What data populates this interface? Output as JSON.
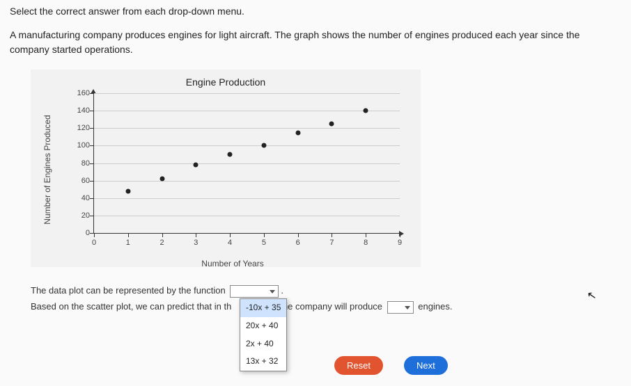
{
  "instruction": "Select the correct answer from each drop-down menu.",
  "context": "A manufacturing company produces engines for light aircraft. The graph shows the number of engines produced each year since the company started operations.",
  "chart_data": {
    "type": "scatter",
    "title": "Engine Production",
    "xlabel": "Number of Years",
    "ylabel": "Number of Engines Produced",
    "xlim": [
      0,
      9
    ],
    "ylim": [
      0,
      160
    ],
    "x_ticks": [
      0,
      1,
      2,
      3,
      4,
      5,
      6,
      7,
      8,
      9
    ],
    "y_ticks": [
      0,
      20,
      40,
      60,
      80,
      100,
      120,
      140,
      160
    ],
    "x": [
      1,
      2,
      3,
      4,
      5,
      6,
      7,
      8
    ],
    "y": [
      48,
      62,
      78,
      90,
      100,
      115,
      125,
      140
    ]
  },
  "sentence1_pre": "The data plot can be represented by the function",
  "sentence2_pre": "Based on the scatter plot, we can predict that in th",
  "sentence2_mid": "the company will produce",
  "sentence2_post": "engines.",
  "dropdown1_options": [
    "-10x + 35",
    "20x + 40",
    "2x + 40",
    "13x + 32"
  ],
  "buttons": {
    "reset": "Reset",
    "next": "Next"
  }
}
